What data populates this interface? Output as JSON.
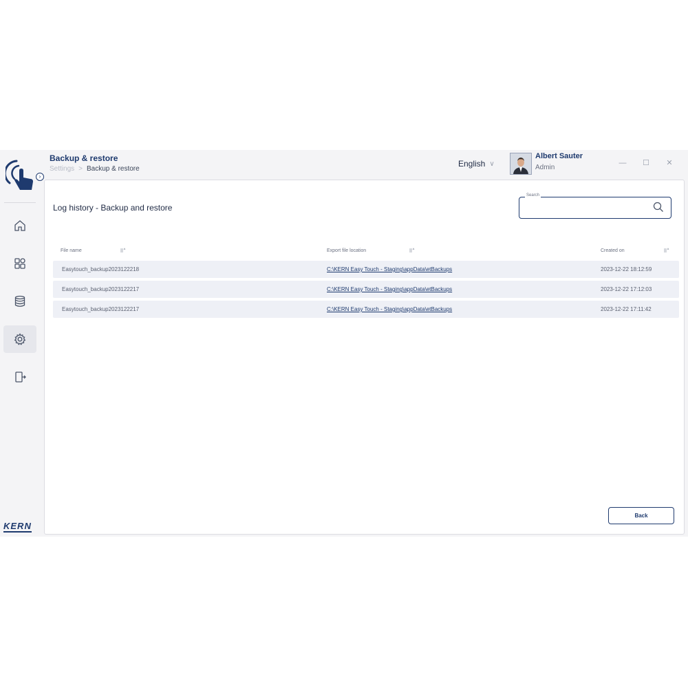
{
  "header": {
    "title": "Backup & restore",
    "breadcrumb": {
      "parent": "Settings",
      "separator": ">",
      "current": "Backup & restore"
    },
    "language": "English"
  },
  "user": {
    "name": "Albert Sauter",
    "role": "Admin"
  },
  "window_controls": {
    "minimize": "—",
    "maximize": "☐",
    "close": "✕"
  },
  "sidebar": {
    "items": [
      {
        "icon": "home-icon"
      },
      {
        "icon": "apps-grid-icon"
      },
      {
        "icon": "database-icon"
      },
      {
        "icon": "gear-icon",
        "active": true
      },
      {
        "icon": "logout-icon"
      }
    ],
    "brand": "KERN"
  },
  "main": {
    "section_title": "Log history - Backup and restore",
    "search": {
      "label": "Search",
      "value": ""
    },
    "table": {
      "columns": [
        "File name",
        "Export file location",
        "Created on"
      ],
      "rows": [
        {
          "file_name": "Easytouch_backup2023122218",
          "location": "C:\\KERN Easy Touch - Staging\\appData\\etBackups",
          "created": "2023-12-22 18:12:59"
        },
        {
          "file_name": "Easytouch_backup2023122217",
          "location": "C:\\KERN Easy Touch - Staging\\appData\\etBackups",
          "created": "2023-12-22 17:12:03"
        },
        {
          "file_name": "Easytouch_backup2023122217",
          "location": "C:\\KERN Easy Touch - Staging\\appData\\etBackups",
          "created": "2023-12-22 17:11:42"
        }
      ]
    },
    "back_label": "Back"
  },
  "colors": {
    "accent": "#1e3a6e",
    "row_bg": "#eef0f6",
    "app_bg": "#f4f4f6"
  }
}
